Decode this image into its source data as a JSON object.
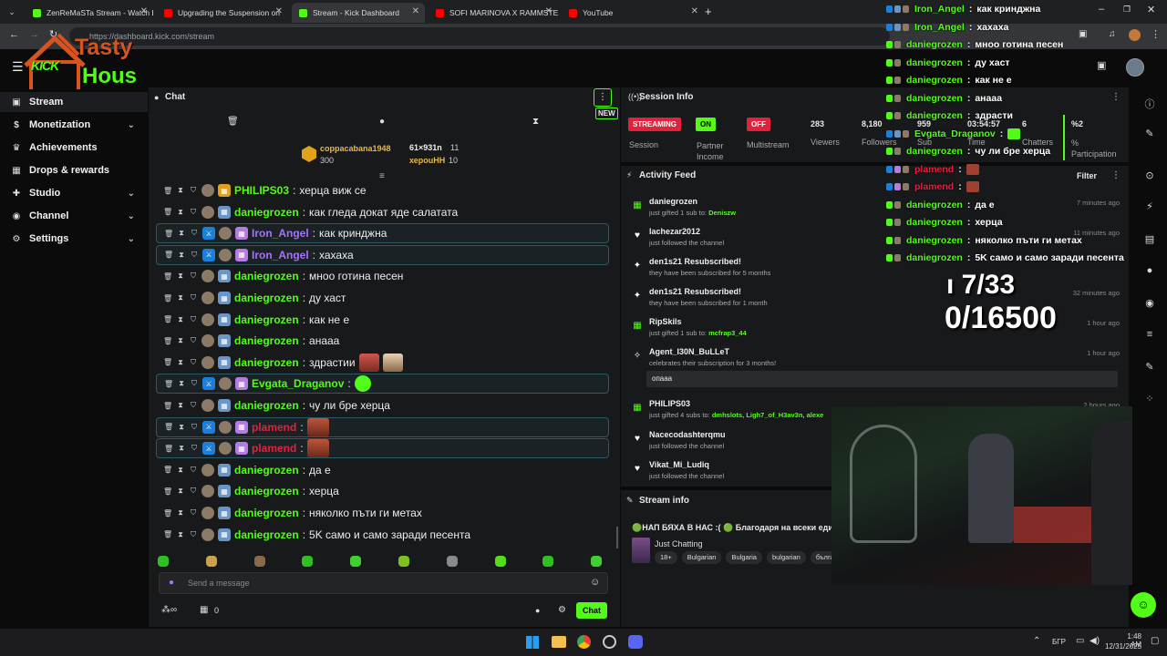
{
  "browser": {
    "tabs": [
      {
        "title": "ZenReMaSTa Stream - Watch Li",
        "fav": "#53fc18"
      },
      {
        "title": "Upgrading the Suspension on",
        "fav": "#ff0000"
      },
      {
        "title": "Stream - Kick Dashboard",
        "fav": "#53fc18",
        "active": true
      },
      {
        "title": "SOFI MARINOVA X RAMMSTE",
        "fav": "#ff0000"
      },
      {
        "title": "YouTube",
        "fav": "#ff0000"
      }
    ],
    "url": "https://dashboard.kick.com/stream"
  },
  "logo": {
    "kick": "KICK",
    "line1": "Tasty",
    "line2": "Hous"
  },
  "sidebar": {
    "items": [
      {
        "label": "Stream",
        "icon": "video-icon",
        "glyph": "▣"
      },
      {
        "label": "Monetization",
        "icon": "dollar-icon",
        "glyph": "$",
        "chevron": true
      },
      {
        "label": "Achievements",
        "icon": "trophy-icon",
        "glyph": "♛"
      },
      {
        "label": "Drops & rewards",
        "icon": "gift-icon",
        "glyph": "▦"
      },
      {
        "label": "Studio",
        "icon": "studio-icon",
        "glyph": "✚",
        "chevron": true
      },
      {
        "label": "Channel",
        "icon": "channel-icon",
        "glyph": "◉",
        "chevron": true
      },
      {
        "label": "Settings",
        "icon": "gear-icon",
        "glyph": "⚙",
        "chevron": true
      }
    ]
  },
  "chat": {
    "title": "Chat",
    "new_label": "NEW",
    "leaders": [
      {
        "name": "coppacabana1948",
        "value": "300"
      },
      {
        "name": "61×931n",
        "value": "11"
      },
      {
        "name": "херouHH",
        "value": "10"
      }
    ],
    "messages": [
      {
        "user": "PHILIPS03",
        "text": "херца виж се",
        "color": "#53fc18",
        "hl": false
      },
      {
        "user": "daniegrozen",
        "text": "как гледа докат яде салатата",
        "color": "#53fc18",
        "hl": false
      },
      {
        "user": "Iron_Angel",
        "text": "как кринджна",
        "color": "#a970ff",
        "hl": true
      },
      {
        "user": "Iron_Angel",
        "text": "хахаха",
        "color": "#a970ff",
        "hl": true
      },
      {
        "user": "daniegrozen",
        "text": "мноо готина песен",
        "color": "#53fc18",
        "hl": false
      },
      {
        "user": "daniegrozen",
        "text": "ду хаст",
        "color": "#53fc18",
        "hl": false
      },
      {
        "user": "daniegrozen",
        "text": "как не е",
        "color": "#53fc18",
        "hl": false
      },
      {
        "user": "daniegrozen",
        "text": "анааа",
        "color": "#53fc18",
        "hl": false
      },
      {
        "user": "daniegrozen",
        "text": "здрастии",
        "color": "#53fc18",
        "hl": false
      },
      {
        "user": "Evgata_Draganov",
        "text": "",
        "color": "#53fc18",
        "hl": true
      },
      {
        "user": "daniegrozen",
        "text": "чу ли бре херца",
        "color": "#53fc18",
        "hl": false
      },
      {
        "user": "plamend",
        "text": "",
        "color": "#e0223c",
        "hl": true
      },
      {
        "user": "plamend",
        "text": "",
        "color": "#e0223c",
        "hl": true
      },
      {
        "user": "daniegrozen",
        "text": "да е",
        "color": "#53fc18",
        "hl": false
      },
      {
        "user": "daniegrozen",
        "text": "херца",
        "color": "#53fc18",
        "hl": false
      },
      {
        "user": "daniegrozen",
        "text": "няколко пъти ги метах",
        "color": "#53fc18",
        "hl": false
      },
      {
        "user": "daniegrozen",
        "text": "5K само и само заради песента",
        "color": "#53fc18",
        "hl": false
      }
    ],
    "placeholder": "Send a message",
    "points": "0",
    "send_label": "Chat"
  },
  "session": {
    "title": "Session Info",
    "session_status": "STREAMING",
    "session_label": "Session",
    "partner_status": "ON",
    "partner_label": "Partner Income",
    "multistream_status": "OFF",
    "multistream_label": "Multistream",
    "viewers": "283",
    "viewers_label": "Viewers",
    "followers": "8,180",
    "followers_label": "Followers",
    "subs": "959",
    "subs_label": "Sub",
    "time": "03:54:57",
    "time_label": "Time",
    "chatters": "6",
    "chatters_label": "Chatters",
    "participation": "%2",
    "participation_label": "% Participation"
  },
  "activity": {
    "title": "Activity Feed",
    "filter_label": "Filter",
    "items": [
      {
        "name": "daniegrozen",
        "desc": "just gifted 1 sub to:",
        "target": "Deniszw",
        "time": "7 minutes ago",
        "glyph": "▦",
        "color": "#53fc18"
      },
      {
        "name": "lachezar2012",
        "desc": "just followed the channel",
        "target": "",
        "time": "11 minutes ago",
        "glyph": "♥",
        "color": "#ffffff"
      },
      {
        "name": "den1s21 Resubscribed!",
        "desc": "they have been subscribed for 5 months",
        "target": "",
        "time": "",
        "glyph": "✦",
        "color": "#ffffff"
      },
      {
        "name": "den1s21 Resubscribed!",
        "desc": "they have been subscribed for 1 month",
        "target": "",
        "time": "32 minutes ago",
        "glyph": "✦",
        "color": "#ffffff"
      },
      {
        "name": "RipSkils",
        "desc": "just gifted 1 sub to:",
        "target": "mcfrap3_44",
        "time": "1 hour ago",
        "glyph": "▦",
        "color": "#53fc18"
      },
      {
        "name": "Agent_I30N_BuLLeT",
        "desc": "celebrates their subscription for 3 months!",
        "target": "",
        "time": "1 hour ago",
        "glyph": "✧",
        "color": "#ffffff",
        "note": "опааа"
      },
      {
        "name": "PHILIPS03",
        "desc": "just gifted 4 subs to:",
        "target": "dmhslots, Ligh7_of_H3av3n, alexe",
        "time": "2 hours ago",
        "glyph": "▦",
        "color": "#53fc18"
      },
      {
        "name": "Nacecodashterqmu",
        "desc": "just followed the channel",
        "target": "",
        "time": "",
        "glyph": "♥",
        "color": "#ffffff"
      },
      {
        "name": "Vikat_Mi_Ludiq",
        "desc": "just followed the channel",
        "target": "",
        "time": "",
        "glyph": "♥",
        "color": "#ffffff"
      }
    ]
  },
  "stream_info": {
    "title": "Stream info",
    "stream_title": "🟢НАП БЯХА В НАС :( 🟢 Благодаря на всеки един",
    "category": "Just Chatting",
    "tags": [
      "18+",
      "Bulgarian",
      "Bulgaria",
      "bulgarian",
      "бълга"
    ]
  },
  "overlay": {
    "goal1": "ı 7/33",
    "goal2": "0/16500",
    "messages": [
      {
        "user": "Iron_Angel",
        "text": "как кринджна",
        "color": "#53fc18"
      },
      {
        "user": "Iron_Angel",
        "text": "хахаха",
        "color": "#53fc18"
      },
      {
        "user": "daniegrozen",
        "text": "мноо готина песен",
        "color": "#53fc18"
      },
      {
        "user": "daniegrozen",
        "text": "ду хаст",
        "color": "#53fc18"
      },
      {
        "user": "daniegrozen",
        "text": "как не е",
        "color": "#53fc18"
      },
      {
        "user": "daniegrozen",
        "text": "анааа",
        "color": "#53fc18"
      },
      {
        "user": "daniegrozen",
        "text": "здрасти",
        "color": "#53fc18"
      },
      {
        "user": "Evgata_Draganov",
        "text": "",
        "color": "#53fc18"
      },
      {
        "user": "daniegrozen",
        "text": "чу ли бре херца",
        "color": "#53fc18"
      },
      {
        "user": "plamend",
        "text": "",
        "color": "#e0223c"
      },
      {
        "user": "plamend",
        "text": "",
        "color": "#e0223c"
      },
      {
        "user": "daniegrozen",
        "text": "да е",
        "color": "#53fc18"
      },
      {
        "user": "daniegrozen",
        "text": "херца",
        "color": "#53fc18"
      },
      {
        "user": "daniegrozen",
        "text": "няколко пъти ги метах",
        "color": "#53fc18"
      },
      {
        "user": "daniegrozen",
        "text": "5K само и само заради песента",
        "color": "#53fc18"
      }
    ]
  },
  "taskbar": {
    "lang": "БГР",
    "time": "1:48 AM",
    "date": "12/31/2025"
  }
}
